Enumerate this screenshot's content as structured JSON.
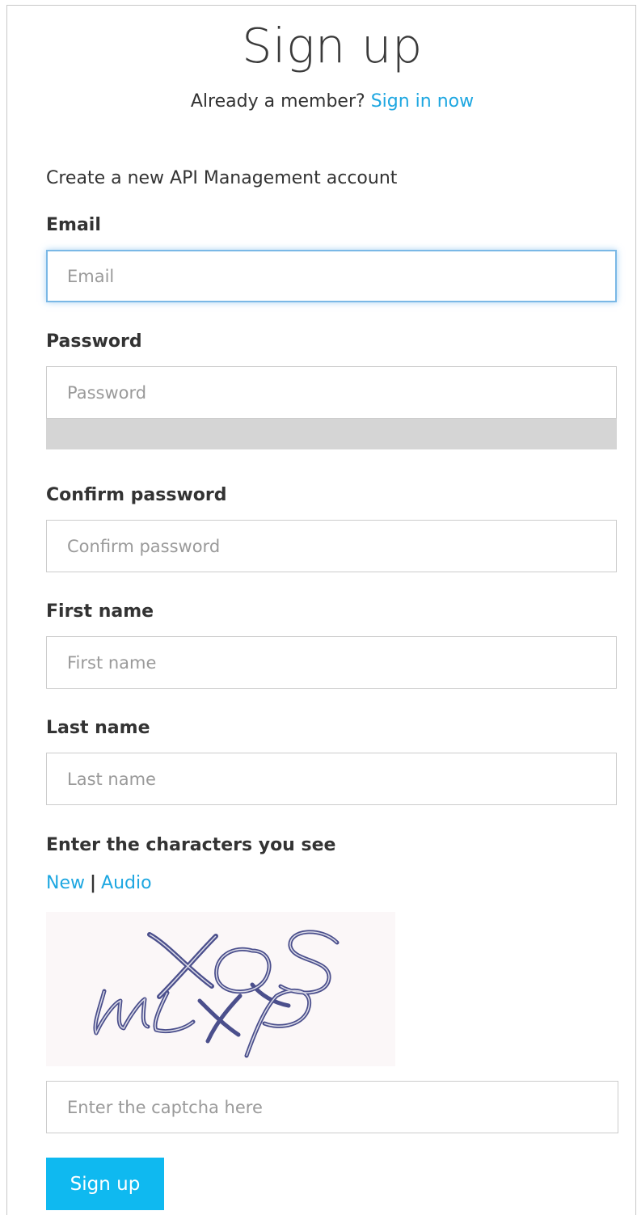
{
  "header": {
    "title": "Sign up",
    "member_prompt": "Already a member?",
    "sign_in_link": "Sign in now"
  },
  "form": {
    "intro": "Create a new API Management account",
    "email": {
      "label": "Email",
      "placeholder": "Email",
      "value": ""
    },
    "password": {
      "label": "Password",
      "placeholder": "Password",
      "value": ""
    },
    "confirm_password": {
      "label": "Confirm password",
      "placeholder": "Confirm password",
      "value": ""
    },
    "first_name": {
      "label": "First name",
      "placeholder": "First name",
      "value": ""
    },
    "last_name": {
      "label": "Last name",
      "placeholder": "Last name",
      "value": ""
    },
    "captcha": {
      "label": "Enter the characters you see",
      "new_link": "New",
      "separator": "|",
      "audio_link": "Audio",
      "image_text": "XQS WLXP",
      "placeholder": "Enter the captcha here",
      "value": ""
    },
    "submit_label": "Sign up"
  },
  "colors": {
    "link": "#1ea7e1",
    "button": "#0fb9f0",
    "focus_border": "#7ab8e6",
    "strength_bar": "#d5d5d5"
  }
}
